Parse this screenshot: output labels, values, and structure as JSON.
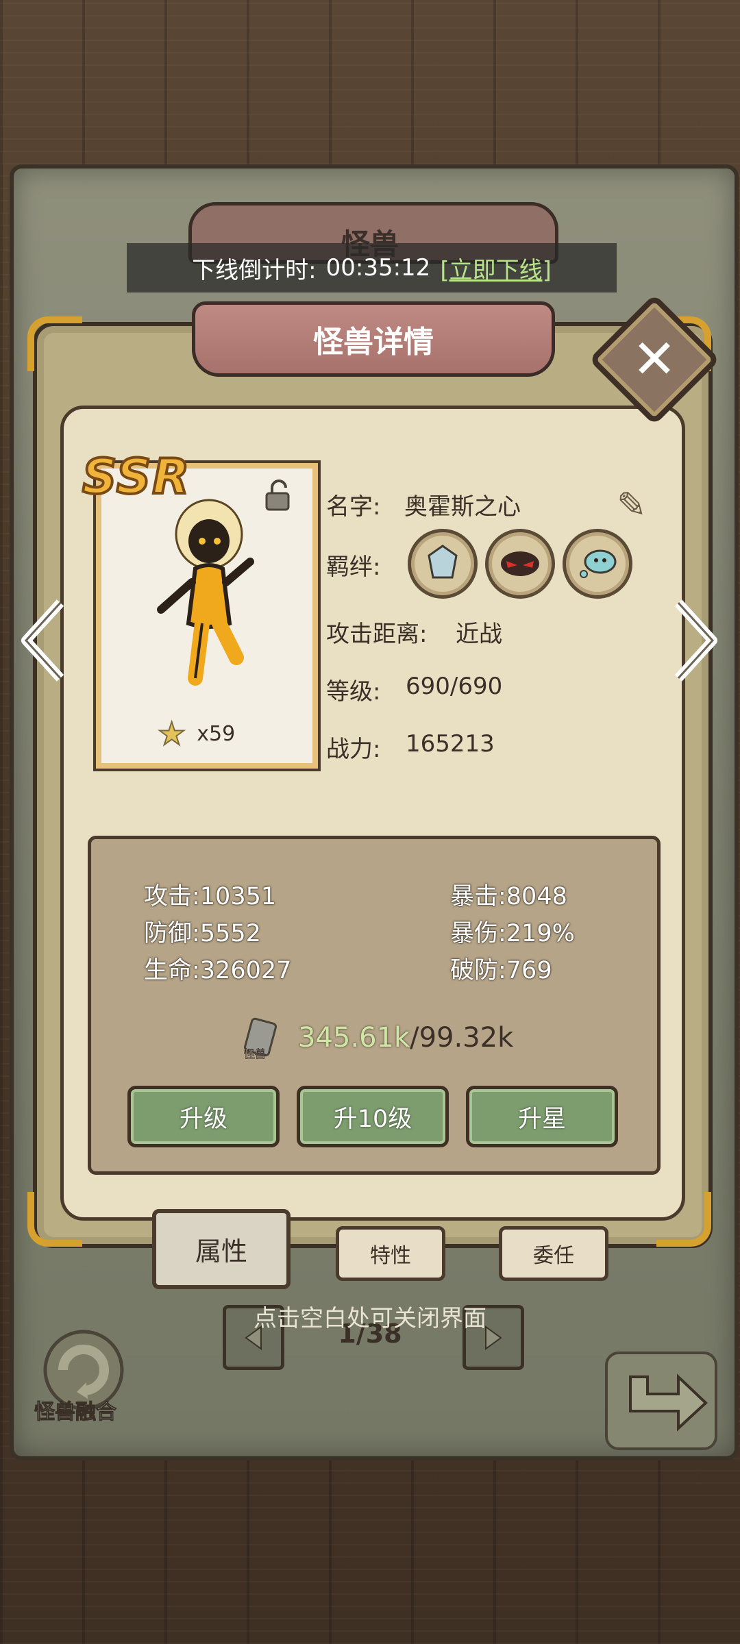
{
  "header": {
    "title": "怪兽",
    "offline_label": "下线倒计时:",
    "offline_time": "00:35:12",
    "offline_action": "[立即下线]"
  },
  "dialog": {
    "title": "怪兽详情"
  },
  "card": {
    "rarity": "SSR",
    "star_count": "x59"
  },
  "info": {
    "name_label": "名字:",
    "name_value": "奥霍斯之心",
    "bond_label": "羁绊:",
    "range_label": "攻击距离:",
    "range_value": "近战",
    "level_label": "等级:",
    "level_value": "690/690",
    "power_label": "战力:",
    "power_value": "165213"
  },
  "stats": {
    "attack": "攻击:10351",
    "defense": "防御:5552",
    "hp": "生命:326027",
    "crit": "暴击:8048",
    "crit_damage": "暴伤:219%",
    "penetration": "破防:769"
  },
  "exp": {
    "icon_label": "怪兽",
    "current": "345.61k",
    "separator": "/",
    "required": "99.32k"
  },
  "buttons": {
    "upgrade": "升级",
    "upgrade10": "升10级",
    "star_up": "升星"
  },
  "tabs": {
    "attributes": "属性",
    "traits": "特性",
    "commission": "委任"
  },
  "footer": {
    "hint": "点击空白处可关闭界面",
    "page": "1/38",
    "fusion": "怪兽融合"
  },
  "colors": {
    "accent_gold": "#d6a12e",
    "button_green": "#7d9d6f",
    "ribbon_pink": "#a8726c",
    "exp_green": "#cfe7a5"
  }
}
